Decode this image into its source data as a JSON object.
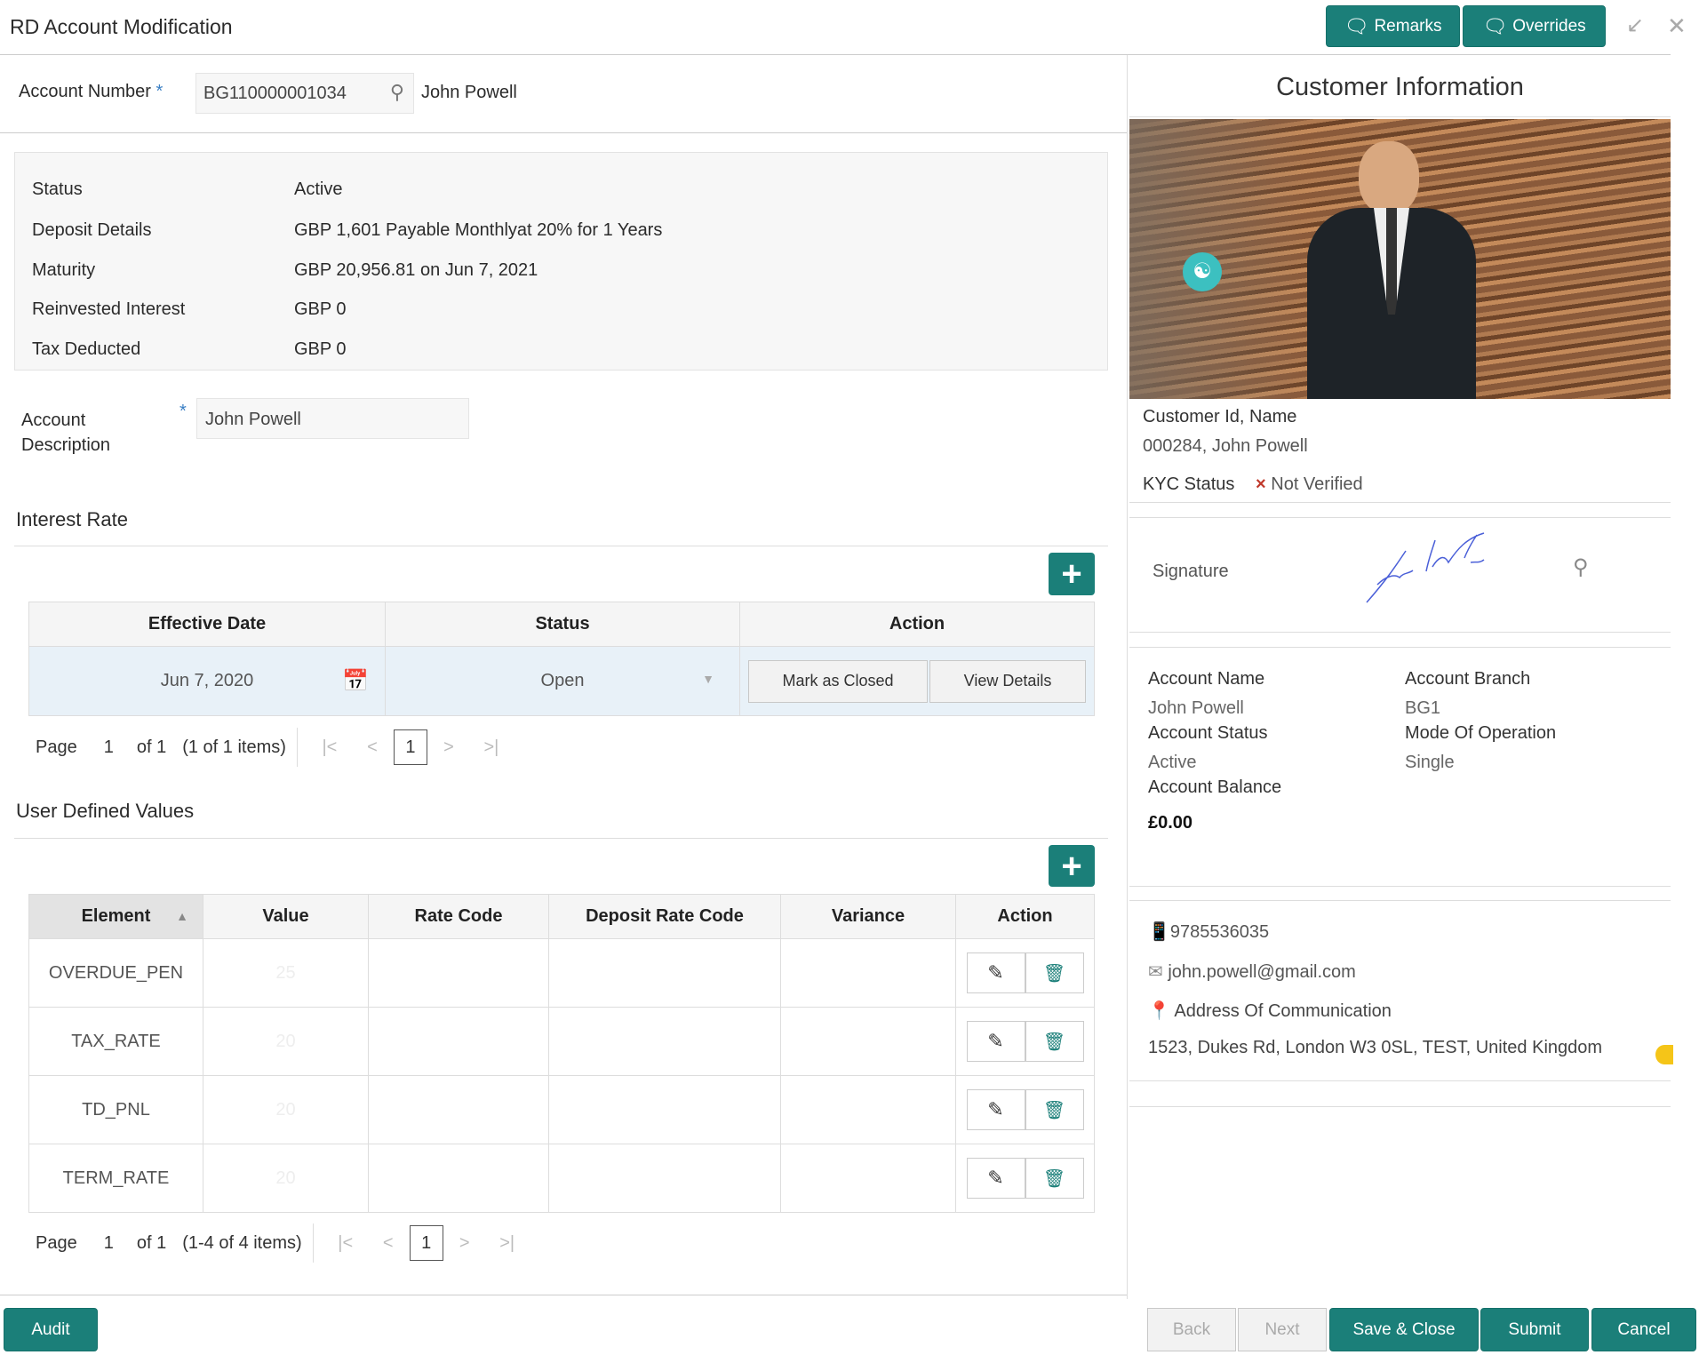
{
  "header": {
    "title": "RD Account Modification",
    "remarks": "Remarks",
    "overrides": "Overrides"
  },
  "account": {
    "label": "Account Number",
    "required": "*",
    "number": "BG110000001034",
    "name": "John Powell"
  },
  "summary": [
    {
      "label": "Status",
      "value": "Active"
    },
    {
      "label": "Deposit Details",
      "value": "GBP 1,601 Payable Monthlyat 20% for 1 Years"
    },
    {
      "label": "Maturity",
      "value": "GBP 20,956.81 on Jun 7, 2021"
    },
    {
      "label": "Reinvested Interest",
      "value": "GBP 0"
    },
    {
      "label": "Tax Deducted",
      "value": "GBP 0"
    }
  ],
  "description": {
    "label_line1": "Account",
    "label_line2": "Description",
    "required": "*",
    "value": "John Powell"
  },
  "interest": {
    "title": "Interest Rate",
    "headers": [
      "Effective Date",
      "Status",
      "Action"
    ],
    "row": {
      "date": "Jun 7, 2020",
      "status": "Open",
      "mark_closed": "Mark as Closed",
      "view_details": "View Details"
    },
    "pager": {
      "page": "Page",
      "num": "1",
      "of": "of 1",
      "items": "(1 of 1 items)",
      "current": "1"
    }
  },
  "udv": {
    "title": "User Defined Values",
    "headers": [
      "Element",
      "Value",
      "Rate Code",
      "Deposit Rate Code",
      "Variance",
      "Action"
    ],
    "rows": [
      {
        "element": "OVERDUE_PEN",
        "value": "25"
      },
      {
        "element": "TAX_RATE",
        "value": "20"
      },
      {
        "element": "TD_PNL",
        "value": "20"
      },
      {
        "element": "TERM_RATE",
        "value": "20"
      }
    ],
    "pager": {
      "page": "Page",
      "num": "1",
      "of": "of 1",
      "items": "(1-4 of 4 items)",
      "current": "1"
    }
  },
  "customer": {
    "title": "Customer Information",
    "id_label": "Customer Id, Name",
    "id_value": "000284, John Powell",
    "kyc_label": "KYC Status",
    "kyc_value": "Not Verified",
    "signature_label": "Signature",
    "fields": [
      {
        "label": "Account Name",
        "value": "John Powell"
      },
      {
        "label": "Account Branch",
        "value": "BG1"
      },
      {
        "label": "Account Status",
        "value": "Active"
      },
      {
        "label": "Mode Of Operation",
        "value": "Single"
      },
      {
        "label": "Account Balance",
        "value": "£0.00"
      }
    ],
    "phone": "9785536035",
    "email": "john.powell@gmail.com",
    "address_label": "Address Of Communication",
    "address": "1523, Dukes Rd, London W3 0SL, TEST, United Kingdom"
  },
  "footer": {
    "audit": "Audit",
    "back": "Back",
    "next": "Next",
    "save_close": "Save & Close",
    "submit": "Submit",
    "cancel": "Cancel"
  },
  "colors": {
    "accent": "#1b7f79",
    "error": "#c0392b"
  }
}
